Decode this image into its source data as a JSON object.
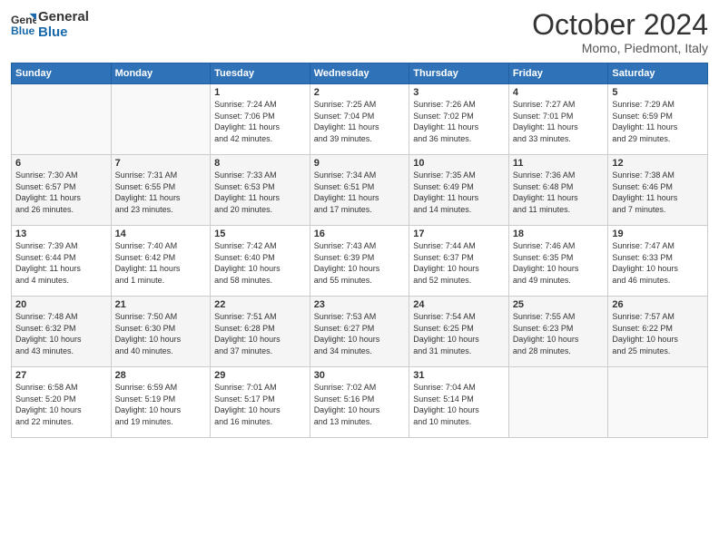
{
  "logo": {
    "line1": "General",
    "line2": "Blue"
  },
  "title": "October 2024",
  "location": "Momo, Piedmont, Italy",
  "days_of_week": [
    "Sunday",
    "Monday",
    "Tuesday",
    "Wednesday",
    "Thursday",
    "Friday",
    "Saturday"
  ],
  "weeks": [
    [
      {
        "num": "",
        "info": ""
      },
      {
        "num": "",
        "info": ""
      },
      {
        "num": "1",
        "info": "Sunrise: 7:24 AM\nSunset: 7:06 PM\nDaylight: 11 hours\nand 42 minutes."
      },
      {
        "num": "2",
        "info": "Sunrise: 7:25 AM\nSunset: 7:04 PM\nDaylight: 11 hours\nand 39 minutes."
      },
      {
        "num": "3",
        "info": "Sunrise: 7:26 AM\nSunset: 7:02 PM\nDaylight: 11 hours\nand 36 minutes."
      },
      {
        "num": "4",
        "info": "Sunrise: 7:27 AM\nSunset: 7:01 PM\nDaylight: 11 hours\nand 33 minutes."
      },
      {
        "num": "5",
        "info": "Sunrise: 7:29 AM\nSunset: 6:59 PM\nDaylight: 11 hours\nand 29 minutes."
      }
    ],
    [
      {
        "num": "6",
        "info": "Sunrise: 7:30 AM\nSunset: 6:57 PM\nDaylight: 11 hours\nand 26 minutes."
      },
      {
        "num": "7",
        "info": "Sunrise: 7:31 AM\nSunset: 6:55 PM\nDaylight: 11 hours\nand 23 minutes."
      },
      {
        "num": "8",
        "info": "Sunrise: 7:33 AM\nSunset: 6:53 PM\nDaylight: 11 hours\nand 20 minutes."
      },
      {
        "num": "9",
        "info": "Sunrise: 7:34 AM\nSunset: 6:51 PM\nDaylight: 11 hours\nand 17 minutes."
      },
      {
        "num": "10",
        "info": "Sunrise: 7:35 AM\nSunset: 6:49 PM\nDaylight: 11 hours\nand 14 minutes."
      },
      {
        "num": "11",
        "info": "Sunrise: 7:36 AM\nSunset: 6:48 PM\nDaylight: 11 hours\nand 11 minutes."
      },
      {
        "num": "12",
        "info": "Sunrise: 7:38 AM\nSunset: 6:46 PM\nDaylight: 11 hours\nand 7 minutes."
      }
    ],
    [
      {
        "num": "13",
        "info": "Sunrise: 7:39 AM\nSunset: 6:44 PM\nDaylight: 11 hours\nand 4 minutes."
      },
      {
        "num": "14",
        "info": "Sunrise: 7:40 AM\nSunset: 6:42 PM\nDaylight: 11 hours\nand 1 minute."
      },
      {
        "num": "15",
        "info": "Sunrise: 7:42 AM\nSunset: 6:40 PM\nDaylight: 10 hours\nand 58 minutes."
      },
      {
        "num": "16",
        "info": "Sunrise: 7:43 AM\nSunset: 6:39 PM\nDaylight: 10 hours\nand 55 minutes."
      },
      {
        "num": "17",
        "info": "Sunrise: 7:44 AM\nSunset: 6:37 PM\nDaylight: 10 hours\nand 52 minutes."
      },
      {
        "num": "18",
        "info": "Sunrise: 7:46 AM\nSunset: 6:35 PM\nDaylight: 10 hours\nand 49 minutes."
      },
      {
        "num": "19",
        "info": "Sunrise: 7:47 AM\nSunset: 6:33 PM\nDaylight: 10 hours\nand 46 minutes."
      }
    ],
    [
      {
        "num": "20",
        "info": "Sunrise: 7:48 AM\nSunset: 6:32 PM\nDaylight: 10 hours\nand 43 minutes."
      },
      {
        "num": "21",
        "info": "Sunrise: 7:50 AM\nSunset: 6:30 PM\nDaylight: 10 hours\nand 40 minutes."
      },
      {
        "num": "22",
        "info": "Sunrise: 7:51 AM\nSunset: 6:28 PM\nDaylight: 10 hours\nand 37 minutes."
      },
      {
        "num": "23",
        "info": "Sunrise: 7:53 AM\nSunset: 6:27 PM\nDaylight: 10 hours\nand 34 minutes."
      },
      {
        "num": "24",
        "info": "Sunrise: 7:54 AM\nSunset: 6:25 PM\nDaylight: 10 hours\nand 31 minutes."
      },
      {
        "num": "25",
        "info": "Sunrise: 7:55 AM\nSunset: 6:23 PM\nDaylight: 10 hours\nand 28 minutes."
      },
      {
        "num": "26",
        "info": "Sunrise: 7:57 AM\nSunset: 6:22 PM\nDaylight: 10 hours\nand 25 minutes."
      }
    ],
    [
      {
        "num": "27",
        "info": "Sunrise: 6:58 AM\nSunset: 5:20 PM\nDaylight: 10 hours\nand 22 minutes."
      },
      {
        "num": "28",
        "info": "Sunrise: 6:59 AM\nSunset: 5:19 PM\nDaylight: 10 hours\nand 19 minutes."
      },
      {
        "num": "29",
        "info": "Sunrise: 7:01 AM\nSunset: 5:17 PM\nDaylight: 10 hours\nand 16 minutes."
      },
      {
        "num": "30",
        "info": "Sunrise: 7:02 AM\nSunset: 5:16 PM\nDaylight: 10 hours\nand 13 minutes."
      },
      {
        "num": "31",
        "info": "Sunrise: 7:04 AM\nSunset: 5:14 PM\nDaylight: 10 hours\nand 10 minutes."
      },
      {
        "num": "",
        "info": ""
      },
      {
        "num": "",
        "info": ""
      }
    ]
  ]
}
